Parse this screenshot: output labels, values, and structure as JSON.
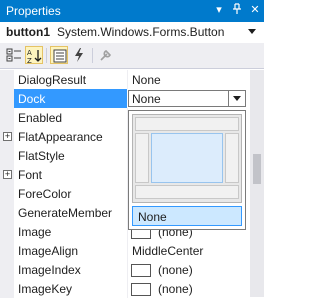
{
  "window": {
    "title": "Properties",
    "buttons": [
      {
        "name": "dropdown-arrow-icon",
        "glyph": "▾"
      },
      {
        "name": "pin-icon",
        "glyph": "ᅮ"
      },
      {
        "name": "close-icon",
        "glyph": "✕"
      }
    ]
  },
  "object_selector": {
    "name": "button1",
    "type": "System.Windows.Forms.Button"
  },
  "toolbar": {
    "tools": [
      "categorized-view-icon",
      "alphabetical-view-icon",
      "properties-icon",
      "events-icon",
      "property-pages-icon"
    ],
    "active": "alphabetical-view-icon"
  },
  "properties": [
    {
      "name": "DialogResult",
      "value": "None"
    },
    {
      "name": "Dock",
      "value": "None",
      "selected": true
    },
    {
      "name": "Enabled",
      "value": ""
    },
    {
      "name": "FlatAppearance",
      "value": "",
      "expandable": true
    },
    {
      "name": "FlatStyle",
      "value": ""
    },
    {
      "name": "Font",
      "value": "",
      "expandable": true
    },
    {
      "name": "ForeColor",
      "value": ""
    },
    {
      "name": "GenerateMember",
      "value": ""
    },
    {
      "name": "Image",
      "value": "(none)",
      "swatch": true
    },
    {
      "name": "ImageAlign",
      "value": "MiddleCenter"
    },
    {
      "name": "ImageIndex",
      "value": "(none)",
      "swatch": true
    },
    {
      "name": "ImageKey",
      "value": "(none)",
      "swatch": true
    }
  ],
  "dock_editor": {
    "options": [
      "Top",
      "Left",
      "Fill",
      "Right",
      "Bottom"
    ],
    "none_label": "None",
    "selected": "None"
  },
  "colors": {
    "title_bar": "#007acc",
    "selection": "#3399ff",
    "toolbar": "#eeeef2"
  }
}
